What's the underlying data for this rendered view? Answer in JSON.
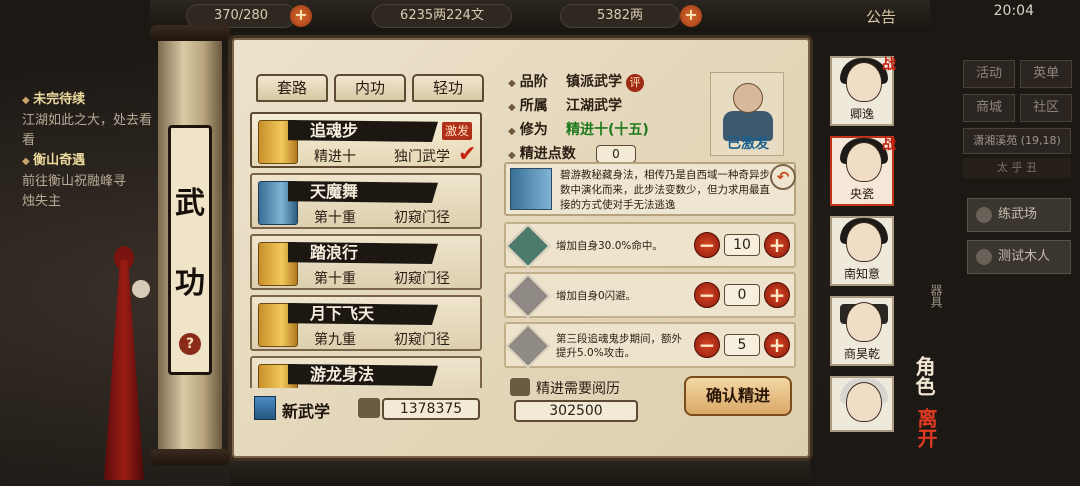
{
  "topbar": {
    "stamina": "370/280",
    "money": "6235两224文",
    "gold": "5382两",
    "notice": "公告",
    "time": "20:04"
  },
  "quests": [
    {
      "title": "未完待续",
      "text": "江湖如此之大，处去看看"
    },
    {
      "title": "衡山奇遇",
      "text": "前往衡山祝融峰寻",
      "text2": "烛失主"
    }
  ],
  "right_panel": {
    "buttons": [
      "活动",
      "英单",
      "商城",
      "社区"
    ],
    "location": "潇湘溪苑 (19,18)",
    "toggle": "太 乎 丑",
    "actions": [
      "练武场",
      "测试木人"
    ]
  },
  "scroll": {
    "title_char1": "武",
    "title_char2": "功",
    "help": "?"
  },
  "tabs": [
    "套路",
    "内功",
    "轻功"
  ],
  "skills": [
    {
      "name": "追魂步",
      "level": "精进十",
      "type": "独门武学",
      "badge": "激发",
      "selected": true,
      "book": "gold"
    },
    {
      "name": "天魔舞",
      "level": "第十重",
      "type": "初窥门径",
      "book": "blue"
    },
    {
      "name": "踏浪行",
      "level": "第十重",
      "type": "初窥门径",
      "book": "gold"
    },
    {
      "name": "月下飞天",
      "level": "第九重",
      "type": "初窥门径",
      "book": "gold"
    },
    {
      "name": "游龙身法",
      "level": "",
      "type": "",
      "book": "gold"
    }
  ],
  "new_skill": {
    "label": "新武学",
    "points": "1378375"
  },
  "detail": {
    "grade_label": "品阶",
    "grade": "镇派武学",
    "grade_tag": "评",
    "belong_label": "所属",
    "belong": "江湖武学",
    "cultivate_label": "修为",
    "cultivate": "精进十(十五)",
    "points_label": "精进点数",
    "points": "0",
    "activated": "已激发",
    "description": "碧游教秘藏身法，相传乃是自西域一种奇异步数中演化而来，此步法变数少，但力求用最直接的方式使对手无法逃逸",
    "effects": [
      {
        "text": "增加自身30.0%命中。",
        "value": "10"
      },
      {
        "text": "增加自身0闪避。",
        "value": "0"
      },
      {
        "text": "第三段追魂鬼步期间，额外提升5.0%攻击。",
        "value": "5"
      }
    ],
    "cost_label": "精进需要阅历",
    "cost": "302500",
    "confirm": "确认精进"
  },
  "characters": [
    {
      "name": "卿逸",
      "zhan": "战"
    },
    {
      "name": "央瓷",
      "zhan": "战"
    },
    {
      "name": "南知意"
    },
    {
      "name": "商昊乾"
    },
    {
      "name": ""
    }
  ],
  "side_labels": {
    "role": "角色",
    "leave": "离开",
    "qiju": "器具"
  }
}
